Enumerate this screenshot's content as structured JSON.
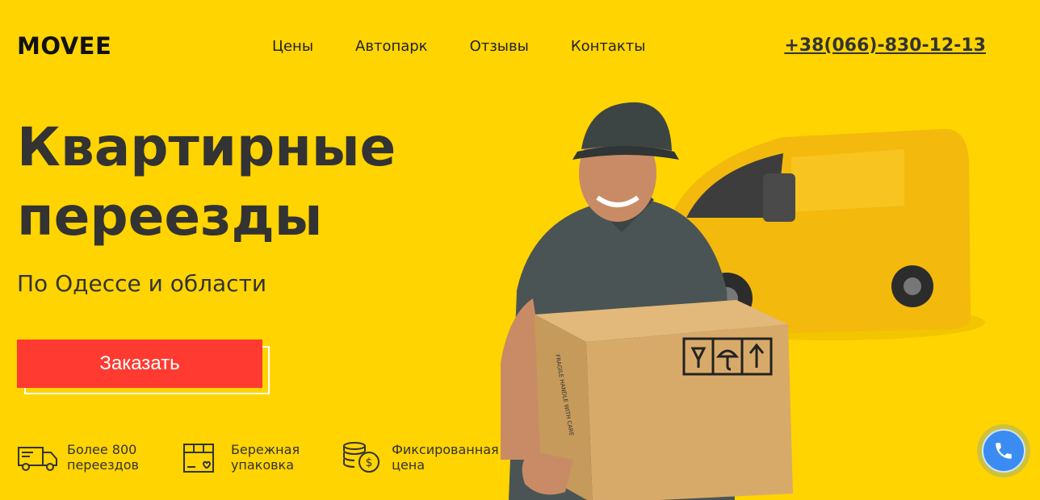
{
  "header": {
    "logo": "MOVEE",
    "nav": [
      "Цены",
      "Автопарк",
      "Отзывы",
      "Контакты"
    ],
    "phone": "+38(066)-830-12-13"
  },
  "hero": {
    "title_line1": "Квартирные",
    "title_line2": "переезды",
    "subtitle": "По Одессе и области",
    "order_button": "Заказать"
  },
  "features": [
    {
      "icon": "truck-icon",
      "line1": "Более 800",
      "line2": "переездов"
    },
    {
      "icon": "package-icon",
      "line1": "Бережная",
      "line2": "упаковка"
    },
    {
      "icon": "coins-icon",
      "line1": "Фиксированная",
      "line2": "цена"
    }
  ],
  "illustration": {
    "subject": "mover-with-box-and-van",
    "box_label": "FRAGILE HANDLE WITH CARE"
  },
  "call_widget": {
    "icon": "phone-icon"
  },
  "colors": {
    "background": "#ffd400",
    "accent": "#ff3a30",
    "call": "#3a8cf2"
  }
}
